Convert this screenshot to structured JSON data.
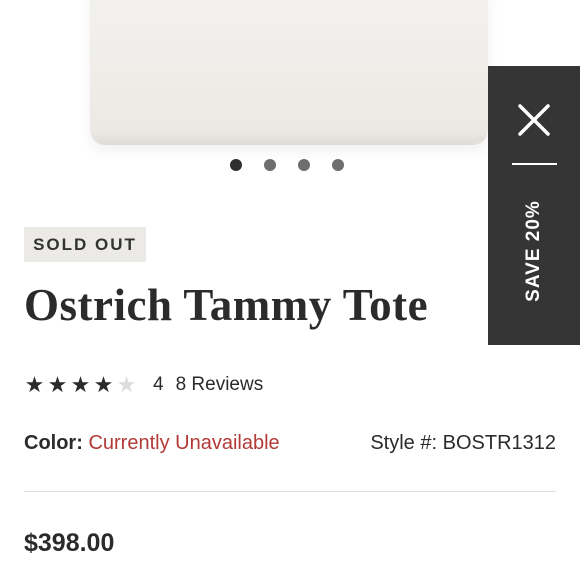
{
  "carousel": {
    "dot_count": 4,
    "active_index": 0
  },
  "badge": {
    "label": "SOLD OUT"
  },
  "product": {
    "title": "Ostrich Tammy Tote",
    "price": "$398.00"
  },
  "rating": {
    "stars_filled": 4,
    "stars_total": 5,
    "value": "4",
    "reviews": "8 Reviews"
  },
  "color": {
    "label": "Color:",
    "value": "Currently Unavailable"
  },
  "style": {
    "label": "Style #:",
    "value": "BOSTR1312"
  },
  "promo_panel": {
    "save_label": "SAVE 20%",
    "close_icon": "close-icon"
  },
  "colors": {
    "accent_red": "#b23a37",
    "panel_bg": "#353535",
    "badge_bg": "#ebeae6"
  }
}
